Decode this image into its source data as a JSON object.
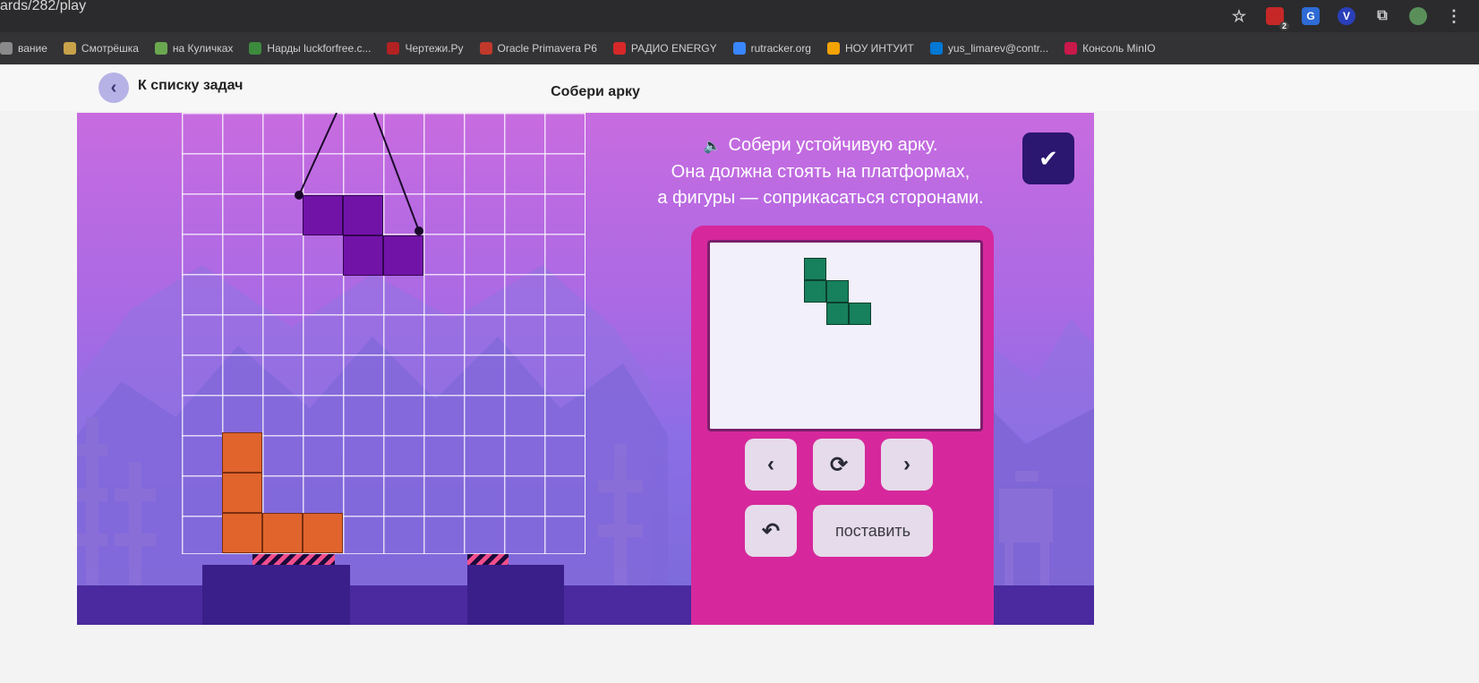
{
  "browser": {
    "url": "ards/282/play",
    "bookmarks": [
      {
        "label": "вание",
        "color": "#8a8a8a"
      },
      {
        "label": "Смотрёшка",
        "color": "#c8a24a"
      },
      {
        "label": "на Куличках",
        "color": "#6aa84f"
      },
      {
        "label": "Нарды luckforfree.c...",
        "color": "#3d8b3d"
      },
      {
        "label": "Чертежи.Ру",
        "color": "#b22222"
      },
      {
        "label": "Oracle Primavera P6",
        "color": "#c0392b"
      },
      {
        "label": "РАДИО ENERGY",
        "color": "#d62828"
      },
      {
        "label": "rutracker.org",
        "color": "#3a86ff"
      },
      {
        "label": "НОУ ИНТУИТ",
        "color": "#f4a300"
      },
      {
        "label": "yus_limarev@contr...",
        "color": "#0078d4"
      },
      {
        "label": "Консоль MinIO",
        "color": "#c9184a"
      }
    ],
    "icons": [
      "star-icon",
      "adblock-icon",
      "translate-icon",
      "vpn-icon",
      "extensions-icon",
      "profile-icon",
      "menu-icon"
    ],
    "adblock_badge": "2",
    "vpn_letter": "V"
  },
  "header": {
    "back_label": "К списку задач",
    "title": "Собери арку"
  },
  "game": {
    "instruction_lines": [
      "Собери устойчивую арку.",
      "Она должна стоять на платформах,",
      "а фигуры — соприкасаться сторонами."
    ],
    "check_icon": "check-icon",
    "colors": {
      "orange": "#e0642c",
      "purple": "#7213a8",
      "green": "#17805c",
      "panel": "#d6289c",
      "check_button": "#2b1670"
    },
    "controls": {
      "prev_icon": "chevron-left-icon",
      "rotate_icon": "rotate-icon",
      "next_icon": "chevron-right-icon",
      "undo_icon": "undo-icon",
      "place_label": "поставить"
    }
  }
}
